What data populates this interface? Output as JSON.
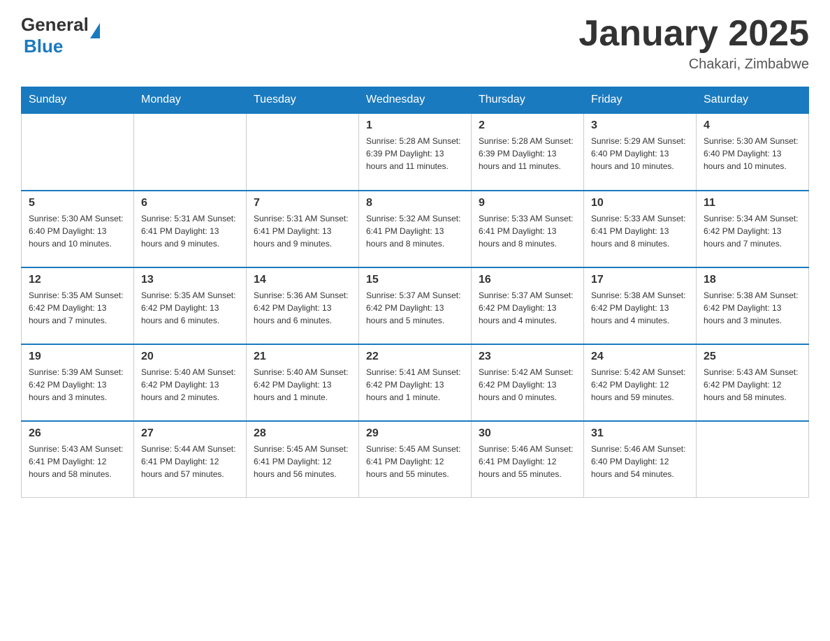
{
  "header": {
    "logo_general": "General",
    "logo_blue": "Blue",
    "title": "January 2025",
    "subtitle": "Chakari, Zimbabwe"
  },
  "days_of_week": [
    "Sunday",
    "Monday",
    "Tuesday",
    "Wednesday",
    "Thursday",
    "Friday",
    "Saturday"
  ],
  "weeks": [
    [
      {
        "day": "",
        "info": ""
      },
      {
        "day": "",
        "info": ""
      },
      {
        "day": "",
        "info": ""
      },
      {
        "day": "1",
        "info": "Sunrise: 5:28 AM\nSunset: 6:39 PM\nDaylight: 13 hours\nand 11 minutes."
      },
      {
        "day": "2",
        "info": "Sunrise: 5:28 AM\nSunset: 6:39 PM\nDaylight: 13 hours\nand 11 minutes."
      },
      {
        "day": "3",
        "info": "Sunrise: 5:29 AM\nSunset: 6:40 PM\nDaylight: 13 hours\nand 10 minutes."
      },
      {
        "day": "4",
        "info": "Sunrise: 5:30 AM\nSunset: 6:40 PM\nDaylight: 13 hours\nand 10 minutes."
      }
    ],
    [
      {
        "day": "5",
        "info": "Sunrise: 5:30 AM\nSunset: 6:40 PM\nDaylight: 13 hours\nand 10 minutes."
      },
      {
        "day": "6",
        "info": "Sunrise: 5:31 AM\nSunset: 6:41 PM\nDaylight: 13 hours\nand 9 minutes."
      },
      {
        "day": "7",
        "info": "Sunrise: 5:31 AM\nSunset: 6:41 PM\nDaylight: 13 hours\nand 9 minutes."
      },
      {
        "day": "8",
        "info": "Sunrise: 5:32 AM\nSunset: 6:41 PM\nDaylight: 13 hours\nand 8 minutes."
      },
      {
        "day": "9",
        "info": "Sunrise: 5:33 AM\nSunset: 6:41 PM\nDaylight: 13 hours\nand 8 minutes."
      },
      {
        "day": "10",
        "info": "Sunrise: 5:33 AM\nSunset: 6:41 PM\nDaylight: 13 hours\nand 8 minutes."
      },
      {
        "day": "11",
        "info": "Sunrise: 5:34 AM\nSunset: 6:42 PM\nDaylight: 13 hours\nand 7 minutes."
      }
    ],
    [
      {
        "day": "12",
        "info": "Sunrise: 5:35 AM\nSunset: 6:42 PM\nDaylight: 13 hours\nand 7 minutes."
      },
      {
        "day": "13",
        "info": "Sunrise: 5:35 AM\nSunset: 6:42 PM\nDaylight: 13 hours\nand 6 minutes."
      },
      {
        "day": "14",
        "info": "Sunrise: 5:36 AM\nSunset: 6:42 PM\nDaylight: 13 hours\nand 6 minutes."
      },
      {
        "day": "15",
        "info": "Sunrise: 5:37 AM\nSunset: 6:42 PM\nDaylight: 13 hours\nand 5 minutes."
      },
      {
        "day": "16",
        "info": "Sunrise: 5:37 AM\nSunset: 6:42 PM\nDaylight: 13 hours\nand 4 minutes."
      },
      {
        "day": "17",
        "info": "Sunrise: 5:38 AM\nSunset: 6:42 PM\nDaylight: 13 hours\nand 4 minutes."
      },
      {
        "day": "18",
        "info": "Sunrise: 5:38 AM\nSunset: 6:42 PM\nDaylight: 13 hours\nand 3 minutes."
      }
    ],
    [
      {
        "day": "19",
        "info": "Sunrise: 5:39 AM\nSunset: 6:42 PM\nDaylight: 13 hours\nand 3 minutes."
      },
      {
        "day": "20",
        "info": "Sunrise: 5:40 AM\nSunset: 6:42 PM\nDaylight: 13 hours\nand 2 minutes."
      },
      {
        "day": "21",
        "info": "Sunrise: 5:40 AM\nSunset: 6:42 PM\nDaylight: 13 hours\nand 1 minute."
      },
      {
        "day": "22",
        "info": "Sunrise: 5:41 AM\nSunset: 6:42 PM\nDaylight: 13 hours\nand 1 minute."
      },
      {
        "day": "23",
        "info": "Sunrise: 5:42 AM\nSunset: 6:42 PM\nDaylight: 13 hours\nand 0 minutes."
      },
      {
        "day": "24",
        "info": "Sunrise: 5:42 AM\nSunset: 6:42 PM\nDaylight: 12 hours\nand 59 minutes."
      },
      {
        "day": "25",
        "info": "Sunrise: 5:43 AM\nSunset: 6:42 PM\nDaylight: 12 hours\nand 58 minutes."
      }
    ],
    [
      {
        "day": "26",
        "info": "Sunrise: 5:43 AM\nSunset: 6:41 PM\nDaylight: 12 hours\nand 58 minutes."
      },
      {
        "day": "27",
        "info": "Sunrise: 5:44 AM\nSunset: 6:41 PM\nDaylight: 12 hours\nand 57 minutes."
      },
      {
        "day": "28",
        "info": "Sunrise: 5:45 AM\nSunset: 6:41 PM\nDaylight: 12 hours\nand 56 minutes."
      },
      {
        "day": "29",
        "info": "Sunrise: 5:45 AM\nSunset: 6:41 PM\nDaylight: 12 hours\nand 55 minutes."
      },
      {
        "day": "30",
        "info": "Sunrise: 5:46 AM\nSunset: 6:41 PM\nDaylight: 12 hours\nand 55 minutes."
      },
      {
        "day": "31",
        "info": "Sunrise: 5:46 AM\nSunset: 6:40 PM\nDaylight: 12 hours\nand 54 minutes."
      },
      {
        "day": "",
        "info": ""
      }
    ]
  ]
}
